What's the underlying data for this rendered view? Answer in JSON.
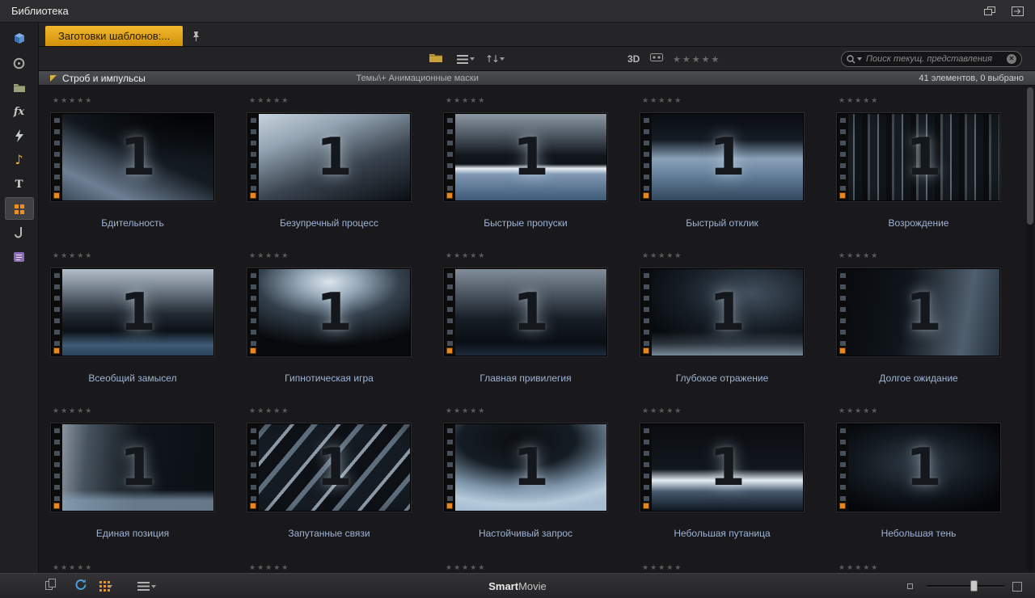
{
  "titlebar": {
    "title": "Библиотека"
  },
  "tabbar": {
    "active_tab": "Заготовки шаблонов:..."
  },
  "toolbar": {
    "three_d": "3D",
    "rating_stars": "★★★★★",
    "search_placeholder": "Поиск текущ. представления"
  },
  "section_header": {
    "title": "Строб и импульсы",
    "path": "Темы\\+ Анимационные маски",
    "status": "41 элементов, 0 выбрано"
  },
  "sidebar": {
    "items": [
      {
        "name": "imports"
      },
      {
        "name": "captures"
      },
      {
        "name": "projects"
      },
      {
        "name": "effects",
        "glyph": "fx"
      },
      {
        "name": "transitions"
      },
      {
        "name": "music",
        "glyph": "♪"
      },
      {
        "name": "titles",
        "glyph": "T"
      },
      {
        "name": "templates",
        "selected": true
      },
      {
        "name": "sound-effects"
      },
      {
        "name": "bonus"
      }
    ]
  },
  "grid": {
    "digit": "1",
    "stars": "★★★★★",
    "items": [
      {
        "name": "Бдительность",
        "variant": 0
      },
      {
        "name": "Безупречный процесс",
        "variant": 1
      },
      {
        "name": "Быстрые пропуски",
        "variant": 2
      },
      {
        "name": "Быстрый отклик",
        "variant": 3
      },
      {
        "name": "Возрождение",
        "variant": 4
      },
      {
        "name": "Всеобщий замысел",
        "variant": 5
      },
      {
        "name": "Гипнотическая игра",
        "variant": 6
      },
      {
        "name": "Главная привилегия",
        "variant": 7
      },
      {
        "name": "Глубокое отражение",
        "variant": 8
      },
      {
        "name": "Долгое ожидание",
        "variant": 9
      },
      {
        "name": "Единая позиция",
        "variant": 10
      },
      {
        "name": "Запутанные связи",
        "variant": 11
      },
      {
        "name": "Настойчивый запрос",
        "variant": 12
      },
      {
        "name": "Небольшая путаница",
        "variant": 13
      },
      {
        "name": "Небольшая тень",
        "variant": 14
      }
    ]
  },
  "footer": {
    "smart": "Smart",
    "movie": "Movie"
  },
  "colors": {
    "accent_gold": "#e2a31c",
    "template_orange": "#e8871e",
    "item_name_text": "#9db3d6",
    "sync_blue": "#4a9fd8"
  }
}
